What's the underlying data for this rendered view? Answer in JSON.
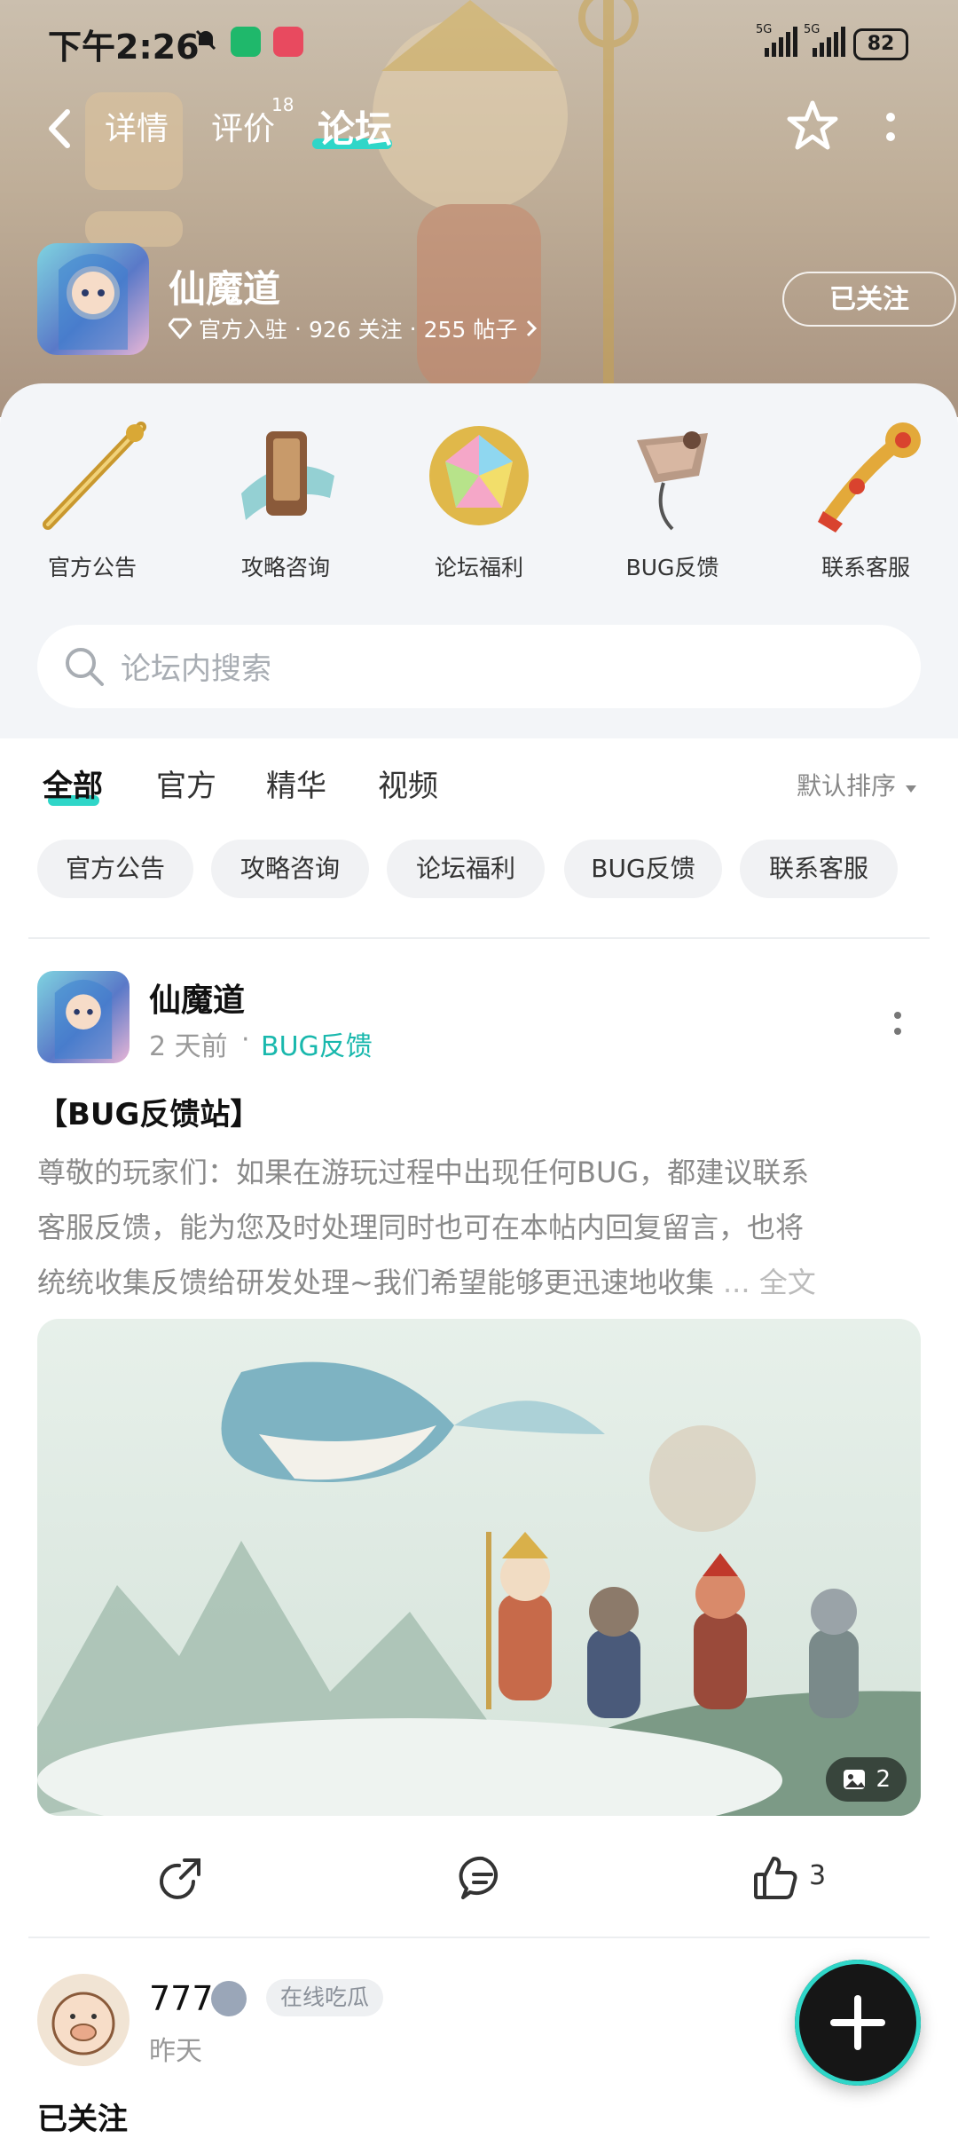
{
  "status_bar": {
    "time": "下午2:26",
    "net1": "5G",
    "net2": "5G",
    "battery": "82"
  },
  "nav": {
    "tabs": [
      {
        "label": "详情"
      },
      {
        "label": "评价",
        "sup": "18"
      },
      {
        "label": "论坛",
        "active": true
      }
    ]
  },
  "game": {
    "name": "仙魔道",
    "official": "官方入驻",
    "followers": "926 关注",
    "posts": "255 帖子",
    "follow_btn": "已关注"
  },
  "categories": [
    {
      "label": "官方公告",
      "icon": "staff-icon"
    },
    {
      "label": "攻略咨询",
      "icon": "scroll-icon"
    },
    {
      "label": "论坛福利",
      "icon": "gem-icon"
    },
    {
      "label": "BUG反馈",
      "icon": "kite-icon"
    },
    {
      "label": "联系客服",
      "icon": "ruyi-icon"
    }
  ],
  "search": {
    "placeholder": "论坛内搜索"
  },
  "filter_tabs": [
    {
      "label": "全部",
      "active": true
    },
    {
      "label": "官方"
    },
    {
      "label": "精华"
    },
    {
      "label": "视频"
    }
  ],
  "sort": "默认排序",
  "chips": [
    "官方公告",
    "攻略咨询",
    "论坛福利",
    "BUG反馈",
    "联系客服"
  ],
  "post": {
    "author": "仙魔道",
    "time": "2 天前",
    "category": "BUG反馈",
    "title": "【BUG反馈站】",
    "lines": [
      "尊敬的玩家们：如果在游玩过程中出现任何BUG，都建议联系",
      "客服反馈，能为您及时处理同时也可在本帖内回复留言，也将",
      "统统收集反馈给研发处理~我们希望能够更迅速地收集 "
    ],
    "ellipsis": "... 全文",
    "image_count": "2",
    "likes": "3"
  },
  "post2": {
    "author": "777",
    "tag": "在线吃瓜",
    "time": "昨天",
    "title": "已关注"
  },
  "colors": {
    "accent": "#2fd6c8",
    "category_link": "#19b8ad"
  }
}
